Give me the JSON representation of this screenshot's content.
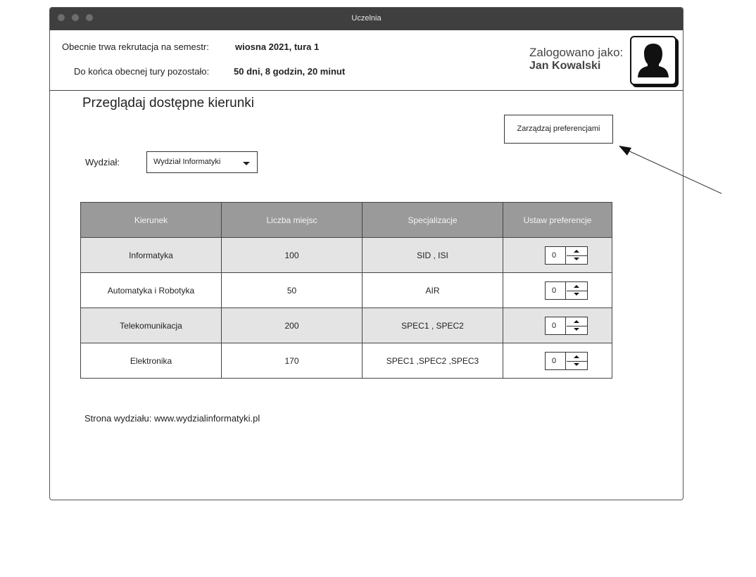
{
  "window": {
    "title": "Uczelnia"
  },
  "header": {
    "recruitment_label": "Obecnie trwa rekrutacja na semestr:",
    "recruitment_value": "wiosna 2021, tura 1",
    "remaining_label": "Do końca obecnej tury pozostało:",
    "remaining_value": "50 dni, 8 godzin, 20 minut",
    "logged_in_label": "Zalogowano jako:",
    "user_name": "Jan Kowalski",
    "avatar_icon": "user-avatar-icon"
  },
  "main": {
    "title": "Przeglądaj dostępne kierunki",
    "manage_button": "Zarządzaj preferencjami",
    "department_label": "Wydział:",
    "department_selected": "Wydział Informatyki",
    "table": {
      "columns": [
        "Kierunek",
        "Liczba miejsc",
        "Specjalizacje",
        "Ustaw preferencje"
      ],
      "rows": [
        {
          "name": "Informatyka",
          "seats": "100",
          "specs": "SID , ISI",
          "preference": "0"
        },
        {
          "name": "Automatyka i Robotyka",
          "seats": "50",
          "specs": "AIR",
          "preference": "0"
        },
        {
          "name": "Telekomunikacja",
          "seats": "200",
          "specs": "SPEC1 , SPEC2",
          "preference": "0"
        },
        {
          "name": "Elektronika",
          "seats": "170",
          "specs": "SPEC1 ,SPEC2 ,SPEC3",
          "preference": "0"
        }
      ]
    },
    "footer_label": "Strona wydziału:",
    "footer_link": "www.wydzialinformatyki.pl"
  },
  "colors": {
    "titlebar": "#3f3f3f",
    "table_header": "#9a9a9a",
    "row_shaded": "#e4e4e4"
  }
}
